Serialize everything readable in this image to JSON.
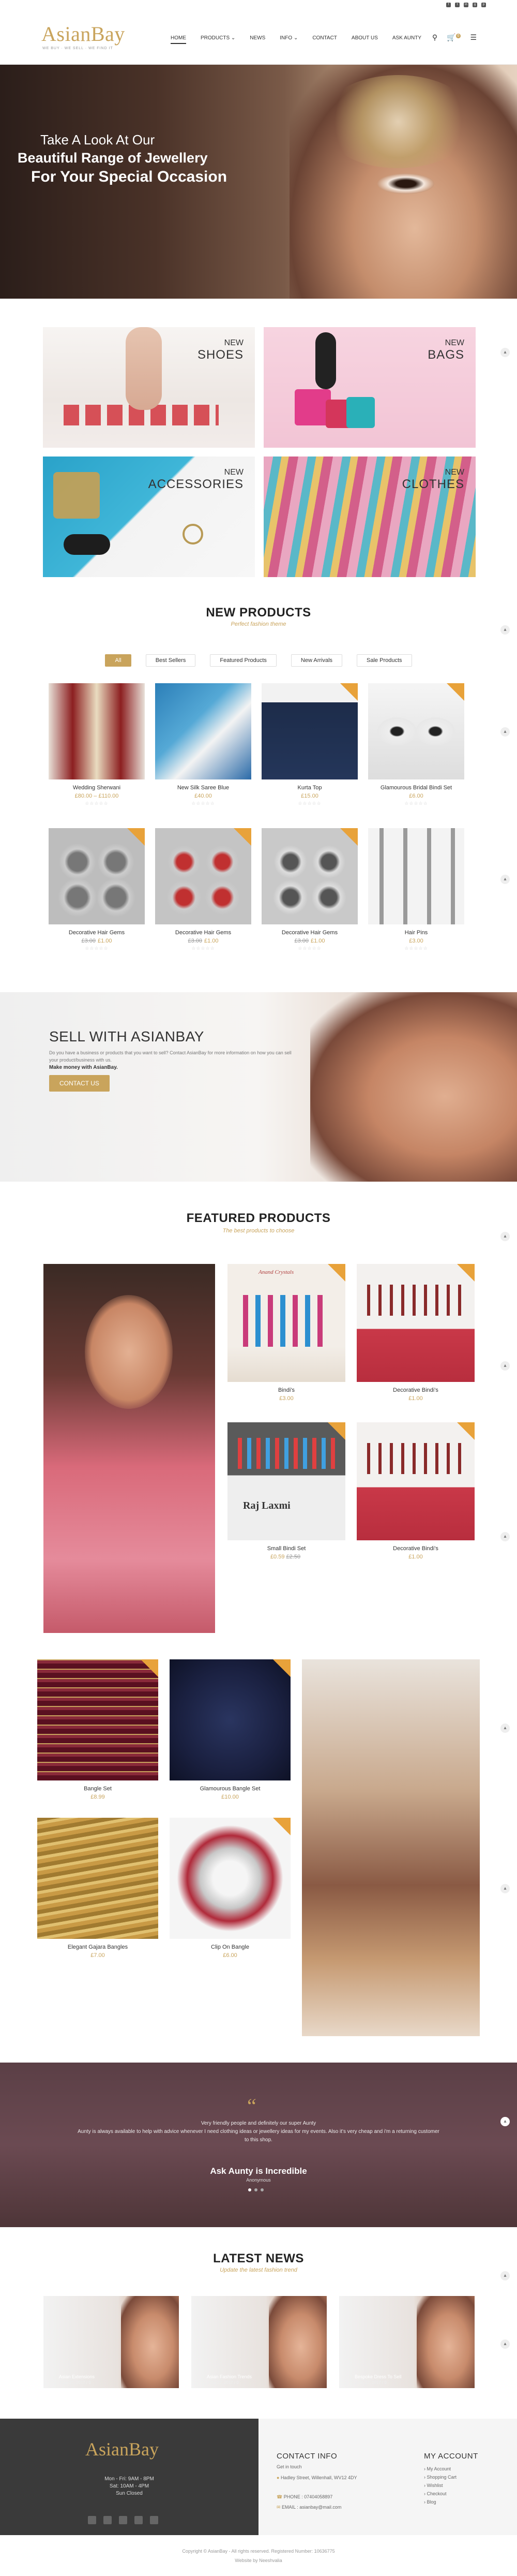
{
  "header": {
    "logo": "AsianBay",
    "tagline": "WE BUY · WE SELL · WE FIND IT",
    "nav": [
      "HOME",
      "PRODUCTS ⌄",
      "NEWS",
      "INFO ⌄",
      "CONTACT",
      "ABOUT US",
      "ASK AUNTY"
    ],
    "cart_count": "0"
  },
  "hero": {
    "line1": "Take A Look At Our",
    "line2": "Beautiful Range of Jewellery",
    "line3": "For Your Special Occasion"
  },
  "categories": [
    {
      "tag": "NEW",
      "label": "SHOES"
    },
    {
      "tag": "NEW",
      "label": "BAGS"
    },
    {
      "tag": "NEW",
      "label": "ACCESSORIES"
    },
    {
      "tag": "NEW",
      "label": "CLOTHES"
    }
  ],
  "new_products": {
    "title": "NEW PRODUCTS",
    "subtitle": "Perfect fashion theme",
    "tabs": [
      "All",
      "Best Sellers",
      "Featured Products",
      "New Arrivals",
      "Sale Products"
    ],
    "items": [
      {
        "name": "Wedding Sherwani",
        "price": "£80.00 – £110.00",
        "old": ""
      },
      {
        "name": "New Silk Saree Blue",
        "price": "£40.00",
        "old": ""
      },
      {
        "name": "Kurta Top",
        "price": "£15.00",
        "old": ""
      },
      {
        "name": "Glamourous Bridal Bindi Set",
        "price": "£6.00",
        "old": ""
      },
      {
        "name": "Decorative Hair Gems",
        "price": "£1.00",
        "old": "£3.00"
      },
      {
        "name": "Decorative Hair Gems",
        "price": "£1.00",
        "old": "£3.00"
      },
      {
        "name": "Decorative Hair Gems",
        "price": "£1.00",
        "old": "£3.00"
      },
      {
        "name": "Hair Pins",
        "price": "£3.00",
        "old": ""
      }
    ],
    "stars": "☆☆☆☆☆"
  },
  "sell": {
    "title": "SELL WITH ASIANBAY",
    "desc": "Do you have a business or products that you want to sell? Contact AsianBay for more information on how you can sell your product/business with us.",
    "make": "Make  money  with  AsianBay.",
    "button": "CONTACT US"
  },
  "featured": {
    "title": "FEATURED PRODUCTS",
    "subtitle": "The best products to choose",
    "items": [
      {
        "name": "Bindi's",
        "price": "£3.00",
        "old": ""
      },
      {
        "name": "Decorative Bindi's",
        "price": "£1.00",
        "old": ""
      },
      {
        "name": "Small Bindi Set",
        "price": "£0.59",
        "old": "£2.50"
      },
      {
        "name": "Decorative Bindi's",
        "price": "£1.00",
        "old": ""
      },
      {
        "name": "Bangle Set",
        "price": "£8.99",
        "old": ""
      },
      {
        "name": "Glamourous Bangle Set",
        "price": "£10.00",
        "old": ""
      },
      {
        "name": "Elegant Gajara Bangles",
        "price": "£7.00",
        "old": ""
      },
      {
        "name": "Clip On Bangle",
        "price": "£6.00",
        "old": ""
      }
    ],
    "thumb_labels": [
      "Anand Crystals",
      "Raj Laxmi"
    ]
  },
  "testimonial": {
    "intro": "Very friendly people and definitely our super Aunty",
    "text": "Aunty is always available to help with advice whenever I need clothing ideas or jewellery ideas for my events. Also it's very cheap and i'm a returning customer to this shop.",
    "name": "Ask Aunty is Incredible",
    "role": "Anonymous"
  },
  "news": {
    "title": "LATEST NEWS",
    "subtitle": "Update the latest fashion trend",
    "items": [
      {
        "title": "Asian Extensions",
        "date": "June 22, 2017 / 0"
      },
      {
        "title": "Asian Fashion Trends",
        "date": "June 22, 2017 / 0"
      },
      {
        "title": "Bespoke Dress To Sell",
        "date": "June 22, 2017 / 0"
      }
    ]
  },
  "footer": {
    "logo": "AsianBay",
    "hours": [
      "Mon - Fri: 9AM - 8PM",
      "Sat: 10AM - 4PM",
      "Sun Closed"
    ],
    "contact_title": "CONTACT INFO",
    "contact_sub": "Get in touch",
    "address": "Hadley Street, Willenhall, WV12 4DY",
    "phone": "PHONE : 07404058897",
    "email": "EMAIL : asianbay@mail.com",
    "account_title": "MY ACCOUNT",
    "account_links": [
      "My Account",
      "Shopping Cart",
      "Wishlist",
      "Checkout",
      "Blog"
    ],
    "copyright": "Copyright © AsianBay - All rights reserved. Registered Number: 10636775",
    "credit": "Website by Neeshvalia"
  }
}
